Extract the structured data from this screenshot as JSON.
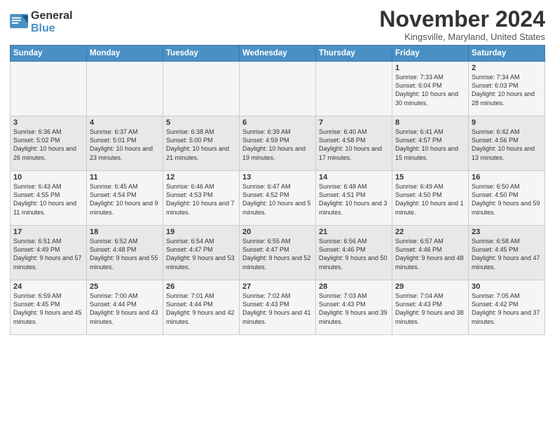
{
  "header": {
    "logo_line1": "General",
    "logo_line2": "Blue",
    "month": "November 2024",
    "location": "Kingsville, Maryland, United States"
  },
  "weekdays": [
    "Sunday",
    "Monday",
    "Tuesday",
    "Wednesday",
    "Thursday",
    "Friday",
    "Saturday"
  ],
  "weeks": [
    [
      {
        "day": "",
        "info": ""
      },
      {
        "day": "",
        "info": ""
      },
      {
        "day": "",
        "info": ""
      },
      {
        "day": "",
        "info": ""
      },
      {
        "day": "",
        "info": ""
      },
      {
        "day": "1",
        "info": "Sunrise: 7:33 AM\nSunset: 6:04 PM\nDaylight: 10 hours and 30 minutes."
      },
      {
        "day": "2",
        "info": "Sunrise: 7:34 AM\nSunset: 6:03 PM\nDaylight: 10 hours and 28 minutes."
      }
    ],
    [
      {
        "day": "3",
        "info": "Sunrise: 6:36 AM\nSunset: 5:02 PM\nDaylight: 10 hours and 26 minutes."
      },
      {
        "day": "4",
        "info": "Sunrise: 6:37 AM\nSunset: 5:01 PM\nDaylight: 10 hours and 23 minutes."
      },
      {
        "day": "5",
        "info": "Sunrise: 6:38 AM\nSunset: 5:00 PM\nDaylight: 10 hours and 21 minutes."
      },
      {
        "day": "6",
        "info": "Sunrise: 6:39 AM\nSunset: 4:59 PM\nDaylight: 10 hours and 19 minutes."
      },
      {
        "day": "7",
        "info": "Sunrise: 6:40 AM\nSunset: 4:58 PM\nDaylight: 10 hours and 17 minutes."
      },
      {
        "day": "8",
        "info": "Sunrise: 6:41 AM\nSunset: 4:57 PM\nDaylight: 10 hours and 15 minutes."
      },
      {
        "day": "9",
        "info": "Sunrise: 6:42 AM\nSunset: 4:56 PM\nDaylight: 10 hours and 13 minutes."
      }
    ],
    [
      {
        "day": "10",
        "info": "Sunrise: 6:43 AM\nSunset: 4:55 PM\nDaylight: 10 hours and 11 minutes."
      },
      {
        "day": "11",
        "info": "Sunrise: 6:45 AM\nSunset: 4:54 PM\nDaylight: 10 hours and 9 minutes."
      },
      {
        "day": "12",
        "info": "Sunrise: 6:46 AM\nSunset: 4:53 PM\nDaylight: 10 hours and 7 minutes."
      },
      {
        "day": "13",
        "info": "Sunrise: 6:47 AM\nSunset: 4:52 PM\nDaylight: 10 hours and 5 minutes."
      },
      {
        "day": "14",
        "info": "Sunrise: 6:48 AM\nSunset: 4:51 PM\nDaylight: 10 hours and 3 minutes."
      },
      {
        "day": "15",
        "info": "Sunrise: 6:49 AM\nSunset: 4:50 PM\nDaylight: 10 hours and 1 minute."
      },
      {
        "day": "16",
        "info": "Sunrise: 6:50 AM\nSunset: 4:50 PM\nDaylight: 9 hours and 59 minutes."
      }
    ],
    [
      {
        "day": "17",
        "info": "Sunrise: 6:51 AM\nSunset: 4:49 PM\nDaylight: 9 hours and 57 minutes."
      },
      {
        "day": "18",
        "info": "Sunrise: 6:52 AM\nSunset: 4:48 PM\nDaylight: 9 hours and 55 minutes."
      },
      {
        "day": "19",
        "info": "Sunrise: 6:54 AM\nSunset: 4:47 PM\nDaylight: 9 hours and 53 minutes."
      },
      {
        "day": "20",
        "info": "Sunrise: 6:55 AM\nSunset: 4:47 PM\nDaylight: 9 hours and 52 minutes."
      },
      {
        "day": "21",
        "info": "Sunrise: 6:56 AM\nSunset: 4:46 PM\nDaylight: 9 hours and 50 minutes."
      },
      {
        "day": "22",
        "info": "Sunrise: 6:57 AM\nSunset: 4:46 PM\nDaylight: 9 hours and 48 minutes."
      },
      {
        "day": "23",
        "info": "Sunrise: 6:58 AM\nSunset: 4:45 PM\nDaylight: 9 hours and 47 minutes."
      }
    ],
    [
      {
        "day": "24",
        "info": "Sunrise: 6:59 AM\nSunset: 4:45 PM\nDaylight: 9 hours and 45 minutes."
      },
      {
        "day": "25",
        "info": "Sunrise: 7:00 AM\nSunset: 4:44 PM\nDaylight: 9 hours and 43 minutes."
      },
      {
        "day": "26",
        "info": "Sunrise: 7:01 AM\nSunset: 4:44 PM\nDaylight: 9 hours and 42 minutes."
      },
      {
        "day": "27",
        "info": "Sunrise: 7:02 AM\nSunset: 4:43 PM\nDaylight: 9 hours and 41 minutes."
      },
      {
        "day": "28",
        "info": "Sunrise: 7:03 AM\nSunset: 4:43 PM\nDaylight: 9 hours and 39 minutes."
      },
      {
        "day": "29",
        "info": "Sunrise: 7:04 AM\nSunset: 4:43 PM\nDaylight: 9 hours and 38 minutes."
      },
      {
        "day": "30",
        "info": "Sunrise: 7:05 AM\nSunset: 4:42 PM\nDaylight: 9 hours and 37 minutes."
      }
    ]
  ]
}
